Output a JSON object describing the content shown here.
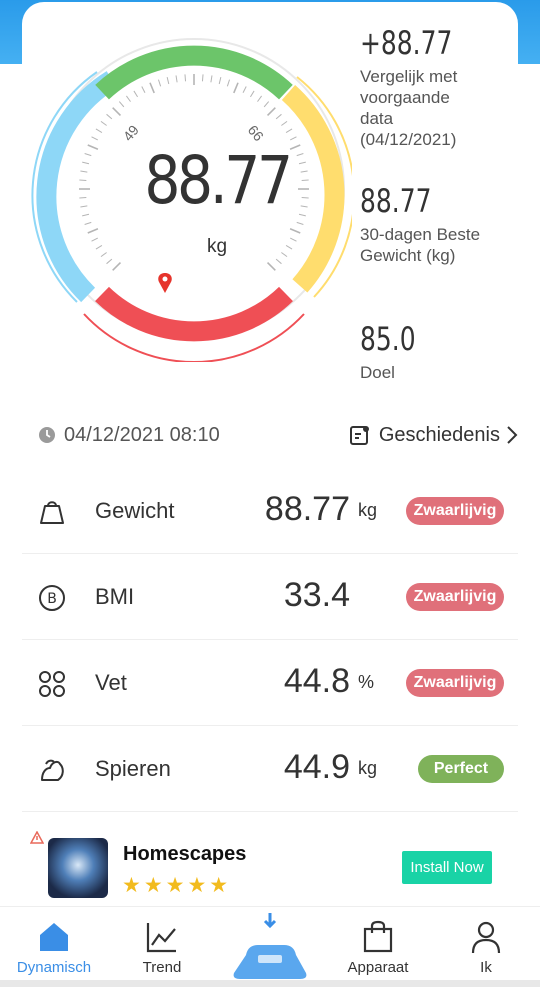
{
  "gauge": {
    "value": "88.77",
    "unit": "kg",
    "tick_low": "49",
    "tick_high": "66",
    "colors": {
      "blue": "#8ed7f7",
      "green": "#6cc56a",
      "yellow": "#ffdd6e",
      "red": "#ef4f55",
      "marker": "#e6342c"
    }
  },
  "stats": {
    "compare_value": "+88.77",
    "compare_label": "Vergelijk met voorgaande data (04/12/2021)",
    "best_value": "88.77",
    "best_label": "30-dagen Beste Gewicht (kg)",
    "goal_value": "85.0",
    "goal_label": "Doel"
  },
  "date_row": {
    "datetime": "04/12/2021 08:10",
    "history_label": "Geschiedenis"
  },
  "metrics": [
    {
      "label": "Gewicht",
      "value": "88.77",
      "unit": "kg",
      "badge": "Zwaarlijvig",
      "badge_color": "#e0707a",
      "icon": "scale-bag-icon"
    },
    {
      "label": "BMI",
      "value": "33.4",
      "unit": "",
      "badge": "Zwaarlijvig",
      "badge_color": "#e0707a",
      "icon": "bmi-icon"
    },
    {
      "label": "Vet",
      "value": "44.8",
      "unit": "%",
      "badge": "Zwaarlijvig",
      "badge_color": "#e0707a",
      "icon": "fat-icon"
    },
    {
      "label": "Spieren",
      "value": "44.9",
      "unit": "kg",
      "badge": "Perfect",
      "badge_color": "#7fb25a",
      "icon": "muscle-icon"
    }
  ],
  "ad": {
    "title": "Homescapes",
    "rating_stars": "★★★★★",
    "button_label": "Install Now"
  },
  "tabs": [
    {
      "label": "Dynamisch",
      "icon": "home-icon",
      "active": true
    },
    {
      "label": "Trend",
      "icon": "trend-chart-icon",
      "active": false
    },
    {
      "label": "",
      "icon": "scale-icon",
      "active": false
    },
    {
      "label": "Apparaat",
      "icon": "shopping-bag-icon",
      "active": false
    },
    {
      "label": "Ik",
      "icon": "user-icon",
      "active": false
    }
  ],
  "colors": {
    "accent": "#3a8ee6",
    "header": "#2a9bea"
  }
}
